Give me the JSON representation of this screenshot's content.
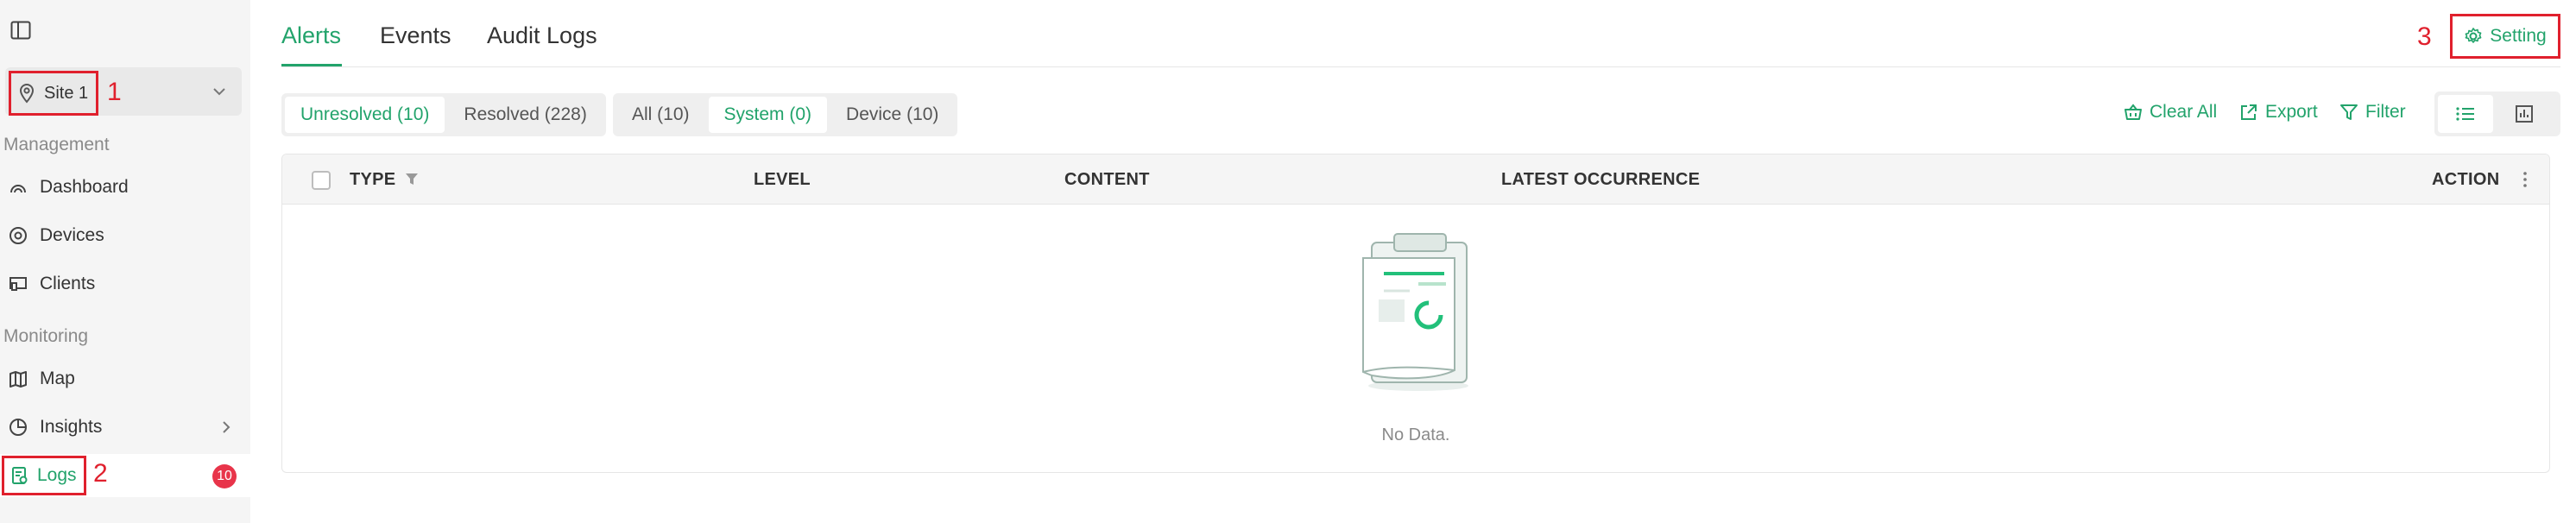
{
  "sidebar": {
    "site": {
      "name": "Site 1"
    },
    "callouts": {
      "site": "1",
      "logs": "2",
      "setting": "3"
    },
    "sections": {
      "management": "Management",
      "monitoring": "Monitoring"
    },
    "items": {
      "dashboard": "Dashboard",
      "devices": "Devices",
      "clients": "Clients",
      "map": "Map",
      "insights": "Insights",
      "logs": "Logs"
    },
    "logs_badge": "10"
  },
  "header": {
    "tabs": [
      "Alerts",
      "Events",
      "Audit Logs"
    ],
    "setting_label": "Setting"
  },
  "filters": {
    "status": [
      "Unresolved (10)",
      "Resolved (228)"
    ],
    "source": [
      "All (10)",
      "System (0)",
      "Device (10)"
    ]
  },
  "actions": {
    "clear_all": "Clear All",
    "export": "Export",
    "filter": "Filter"
  },
  "table": {
    "columns": [
      "TYPE",
      "LEVEL",
      "CONTENT",
      "LATEST OCCURRENCE",
      "ACTION"
    ],
    "empty_text": "No Data."
  },
  "colors": {
    "accent": "#22a36b",
    "annotation": "#e0202d",
    "badge": "#e8344a"
  }
}
